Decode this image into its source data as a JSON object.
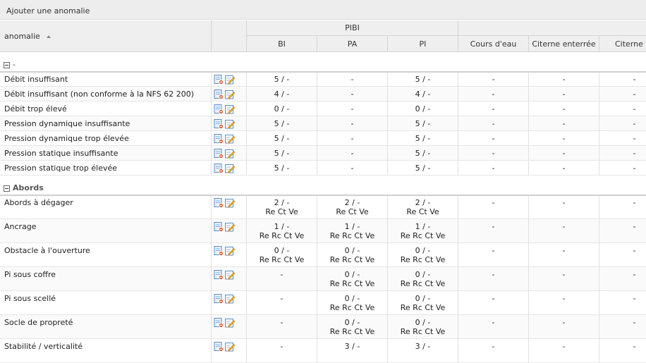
{
  "toolbar": {
    "add_label": "Ajouter une anomalie"
  },
  "header": {
    "anomalie_label": "anomalie",
    "group_pibi": "PIBI",
    "columns": [
      "BI",
      "PA",
      "PI",
      "Cours d'eau",
      "Citerne enterrée",
      "Citerne fi"
    ]
  },
  "groups": [
    {
      "label": "-",
      "rows": [
        {
          "name": "Débit insuffisant",
          "bi": "5 / -",
          "pa": "-",
          "pi": "5 / -",
          "cours": "-",
          "citerne_ent": "-",
          "citerne_fi": "-"
        },
        {
          "name": "Débit insuffisant (non conforme à la NFS 62 200)",
          "bi": "4 / -",
          "pa": "-",
          "pi": "4 / -",
          "cours": "-",
          "citerne_ent": "-",
          "citerne_fi": "-"
        },
        {
          "name": "Débit trop élevé",
          "bi": "0 / -",
          "pa": "-",
          "pi": "0 / -",
          "cours": "-",
          "citerne_ent": "-",
          "citerne_fi": "-"
        },
        {
          "name": "Pression dynamique insuffisante",
          "bi": "5 / -",
          "pa": "-",
          "pi": "5 / -",
          "cours": "-",
          "citerne_ent": "-",
          "citerne_fi": "-"
        },
        {
          "name": "Pression dynamique trop élevée",
          "bi": "5 / -",
          "pa": "-",
          "pi": "5 / -",
          "cours": "-",
          "citerne_ent": "-",
          "citerne_fi": "-"
        },
        {
          "name": "Pression statique insuffisante",
          "bi": "5 / -",
          "pa": "-",
          "pi": "5 / -",
          "cours": "-",
          "citerne_ent": "-",
          "citerne_fi": "-"
        },
        {
          "name": "Pression statique trop élevée",
          "bi": "5 / -",
          "pa": "-",
          "pi": "5 / -",
          "cours": "-",
          "citerne_ent": "-",
          "citerne_fi": "-"
        }
      ]
    },
    {
      "label": "Abords",
      "rows": [
        {
          "name": "Abords à dégager",
          "bi": "2 / -",
          "bi_sub": "Re Ct Ve",
          "pa": "2 / -",
          "pa_sub": "Re Ct Ve",
          "pi": "2 / -",
          "pi_sub": "Re Ct Ve",
          "cours": "-",
          "citerne_ent": "-",
          "citerne_fi": "-"
        },
        {
          "name": "Ancrage",
          "bi": "1 / -",
          "bi_sub": "Re Rc Ct Ve",
          "pa": "1 / -",
          "pa_sub": "Re Rc Ct Ve",
          "pi": "1 / -",
          "pi_sub": "Re Rc Ct Ve",
          "cours": "-",
          "citerne_ent": "-",
          "citerne_fi": "-"
        },
        {
          "name": "Obstacle à l'ouverture",
          "bi": "0 / -",
          "bi_sub": "Re Rc Ct Ve",
          "pa": "0 / -",
          "pa_sub": "Re Rc Ct Ve",
          "pi": "0 / -",
          "pi_sub": "Re Rc Ct Ve",
          "cours": "-",
          "citerne_ent": "-",
          "citerne_fi": "-"
        },
        {
          "name": "Pi sous coffre",
          "bi": "-",
          "bi_sub": "",
          "pa": "0 / -",
          "pa_sub": "Re Rc Ct Ve",
          "pi": "0 / -",
          "pi_sub": "Re Rc Ct Ve",
          "cours": "-",
          "citerne_ent": "-",
          "citerne_fi": "-"
        },
        {
          "name": "Pi sous scellé",
          "bi": "-",
          "bi_sub": "",
          "pa": "0 / -",
          "pa_sub": "Re Rc Ct Ve",
          "pi": "0 / -",
          "pi_sub": "Re Rc Ct Ve",
          "cours": "-",
          "citerne_ent": "-",
          "citerne_fi": "-"
        },
        {
          "name": "Socle de propreté",
          "bi": "-",
          "bi_sub": "",
          "pa": "0 / -",
          "pa_sub": "Re Rc Ct Ve",
          "pi": "0 / -",
          "pi_sub": "Re Rc Ct Ve",
          "cours": "-",
          "citerne_ent": "-",
          "citerne_fi": "-"
        },
        {
          "name": "Stabilité / verticalité",
          "bi": "-",
          "bi_sub": "",
          "pa": "3 / -",
          "pa_sub": "",
          "pi": "3 / -",
          "pi_sub": "",
          "cours": "-",
          "citerne_ent": "-",
          "citerne_fi": "-"
        }
      ]
    }
  ]
}
